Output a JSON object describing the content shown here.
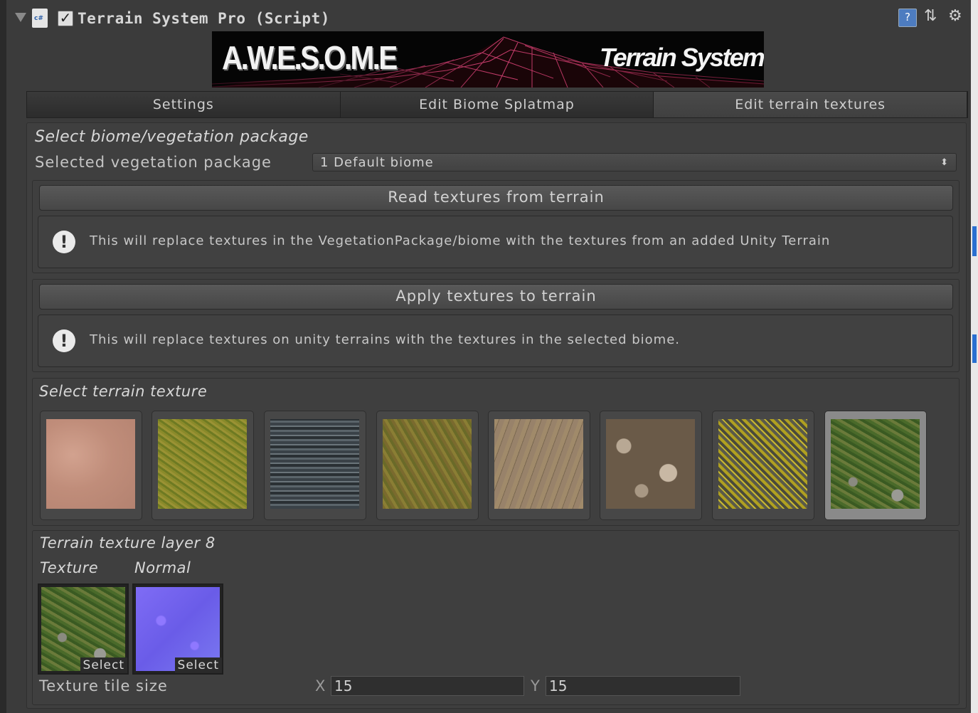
{
  "header": {
    "title": "Terrain System Pro (Script)",
    "script_icon_text": "c#",
    "help_glyph": "?",
    "preset_glyph": "⇅",
    "settings_glyph": "⚙"
  },
  "banner": {
    "logo": "A.W.E.S.O.M.E",
    "subtitle": "Terrain System"
  },
  "tabs": [
    {
      "label": "Settings",
      "active": false
    },
    {
      "label": "Edit Biome Splatmap",
      "active": false
    },
    {
      "label": "Edit terrain textures",
      "active": true
    }
  ],
  "biome_section": {
    "title": "Select biome/vegetation package",
    "field_label": "Selected vegetation package",
    "selected_value": "1 Default biome",
    "dropdown_arrows": "⬍"
  },
  "read_section": {
    "button_label": "Read textures from terrain",
    "help_text": "This will replace textures in the VegetationPackage/biome with the textures from an added Unity Terrain"
  },
  "apply_section": {
    "button_label": "Apply textures to terrain",
    "help_text": "This will replace textures on unity terrains with the textures in the selected biome."
  },
  "info_glyph": "!",
  "texture_select": {
    "title": "Select terrain texture",
    "selected_index": 8
  },
  "layer_section": {
    "title": "Terrain texture layer 8",
    "texture_label": "Texture",
    "normal_label": "Normal",
    "select_label": "Select",
    "tile_size_label": "Texture tile size",
    "x_label": "X",
    "x_value": "15",
    "y_label": "Y",
    "y_value": "15"
  },
  "colors": {
    "panel_bg": "#3b3b3b",
    "banner_accent": "#e0457a",
    "selection_highlight": "#8a8a8a"
  }
}
